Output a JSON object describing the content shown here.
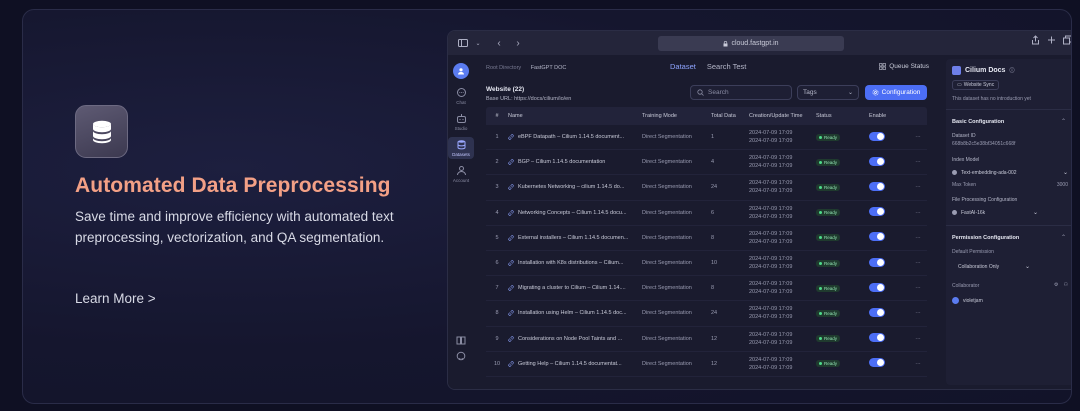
{
  "promo": {
    "title": "Automated Data Preprocessing",
    "description": "Save time and improve efficiency with automated text preprocessing, vectorization, and QA segmentation.",
    "learn_more": "Learn More >",
    "icon": "database-icon"
  },
  "browser": {
    "url": "cloud.fastgpt.in"
  },
  "nav": {
    "items": [
      {
        "label": "Chat",
        "icon": "chat-icon"
      },
      {
        "label": "Studio",
        "icon": "robot-icon"
      },
      {
        "label": "Datasets",
        "icon": "database-icon"
      },
      {
        "label": "Account",
        "icon": "user-icon"
      }
    ]
  },
  "main": {
    "breadcrumb_root": "Root Directory",
    "breadcrumb_current": "FastGPT DOC",
    "tabs": [
      "Dataset",
      "Search Test"
    ],
    "queue_status": "Queue Status",
    "website_title": "Website (22)",
    "base_url": "Base URL: https://docs/cilium/io/en",
    "search_placeholder": "Search",
    "tags_label": "Tags",
    "config_label": "Configuration",
    "columns": [
      "#",
      "Name",
      "Training Mode",
      "Total Data",
      "Creation/Update Time",
      "Status",
      "Enable"
    ],
    "rows": [
      {
        "idx": "1",
        "name": "eBPF Datapath – Cilium 1.14.5 document...",
        "mode": "Direct Segmentation",
        "data": "1",
        "time1": "2024-07-09 17:09",
        "time2": "2024-07-09 17:09",
        "status": "Ready"
      },
      {
        "idx": "2",
        "name": "BGP – Cilium 1.14.5 documentation",
        "mode": "Direct Segmentation",
        "data": "4",
        "time1": "2024-07-09 17:09",
        "time2": "2024-07-09 17:09",
        "status": "Ready"
      },
      {
        "idx": "3",
        "name": "Kubernetes Networking – cilium 1.14.5 do...",
        "mode": "Direct Segmentation",
        "data": "24",
        "time1": "2024-07-09 17:09",
        "time2": "2024-07-09 17:09",
        "status": "Ready"
      },
      {
        "idx": "4",
        "name": "Networking Concepts – Cilium 1.14.5 docu...",
        "mode": "Direct Segmentation",
        "data": "6",
        "time1": "2024-07-09 17:09",
        "time2": "2024-07-09 17:09",
        "status": "Ready"
      },
      {
        "idx": "5",
        "name": "External installers – Cilium 1.14.5 documen...",
        "mode": "Direct Segmentation",
        "data": "8",
        "time1": "2024-07-09 17:09",
        "time2": "2024-07-09 17:09",
        "status": "Ready"
      },
      {
        "idx": "6",
        "name": "Installation with K8s distributions – Cilium...",
        "mode": "Direct Segmentation",
        "data": "10",
        "time1": "2024-07-09 17:09",
        "time2": "2024-07-09 17:09",
        "status": "Ready"
      },
      {
        "idx": "7",
        "name": "Migrating a cluster to Cilium – Cilium 1.14....",
        "mode": "Direct Segmentation",
        "data": "8",
        "time1": "2024-07-09 17:09",
        "time2": "2024-07-09 17:09",
        "status": "Ready"
      },
      {
        "idx": "8",
        "name": "Installation using Helm – Cilium 1.14.5 doc...",
        "mode": "Direct Segmentation",
        "data": "24",
        "time1": "2024-07-09 17:09",
        "time2": "2024-07-09 17:09",
        "status": "Ready"
      },
      {
        "idx": "9",
        "name": "Considerations on Node Pool Taints and ...",
        "mode": "Direct Segmentation",
        "data": "12",
        "time1": "2024-07-09 17:09",
        "time2": "2024-07-09 17:09",
        "status": "Ready"
      },
      {
        "idx": "10",
        "name": "Getting Help – Cilium 1.14.5 documentat...",
        "mode": "Direct Segmentation",
        "data": "12",
        "time1": "2024-07-09 17:09",
        "time2": "2024-07-09 17:09",
        "status": "Ready"
      }
    ]
  },
  "side": {
    "title": "Cilium Docs",
    "sync_label": "Website Sync",
    "no_intro": "This dataset has no introduction yet",
    "basic_config": "Basic Configuration",
    "dataset_id_label": "Dataset ID",
    "dataset_id": "668b8b2c5e38bf34051c668f",
    "index_model_label": "Index Model",
    "index_model": "Text-embedding-ada-002",
    "max_token_label": "Max Token",
    "max_token": "3000",
    "file_proc_label": "File Processing Configuration",
    "file_proc": "FastAI-16k",
    "perm_config": "Permission Configuration",
    "default_perm_label": "Default Permission",
    "default_perm": "Collaboration Only",
    "collaborator_label": "Collaborator",
    "collaborator": "violetjam"
  },
  "colors": {
    "accent": "#4c6ef5",
    "promo_title": "#f3a086",
    "ready": "#4ed98a"
  }
}
